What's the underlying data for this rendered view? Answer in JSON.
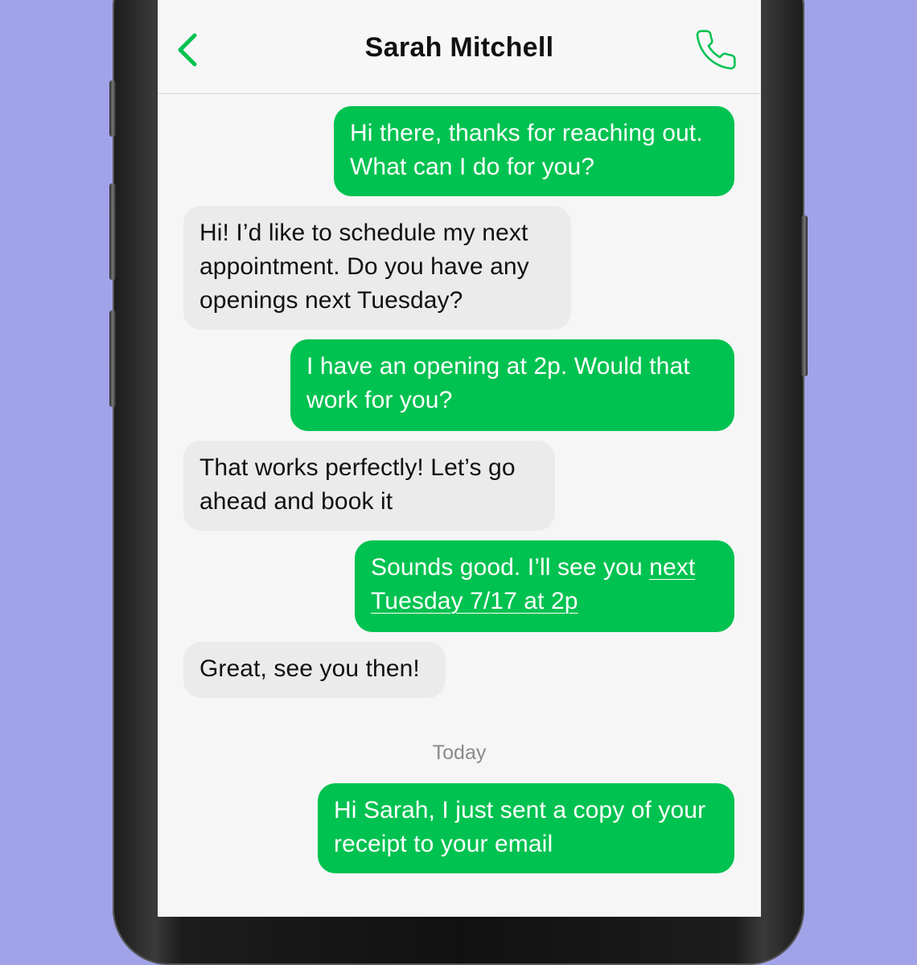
{
  "conversation": {
    "contact_name": "Sarah Mitchell",
    "date_divider": "Today",
    "messages": [
      {
        "direction": "outgoing",
        "lines": [
          "Hi there, thanks for reaching out.",
          "What can I do for you?"
        ]
      },
      {
        "direction": "incoming",
        "lines": [
          "Hi! I’d like to schedule my next",
          "appointment. Do you have any",
          "openings next Tuesday?"
        ]
      },
      {
        "direction": "outgoing",
        "lines": [
          "I have an opening at 2p. Would that",
          "work for you?"
        ]
      },
      {
        "direction": "incoming",
        "lines": [
          "That works perfectly! Let’s go",
          "ahead and book it"
        ]
      },
      {
        "direction": "outgoing",
        "line1_text": "Sounds good. I’ll see you ",
        "line1_link": "next",
        "line2_link": "Tuesday 7/17 at 2p"
      },
      {
        "direction": "incoming",
        "lines": [
          "Great, see you then!"
        ]
      },
      {
        "direction": "outgoing",
        "lines": [
          "Hi Sarah, I just sent a copy of your",
          "receipt to your email"
        ]
      }
    ]
  },
  "icons": {
    "back": "chevron-left-icon",
    "call": "phone-icon"
  },
  "colors": {
    "accent": "#00c250",
    "outgoing_bubble": "#00c250",
    "incoming_bubble": "#ebebeb",
    "background": "#a1a3e8"
  }
}
